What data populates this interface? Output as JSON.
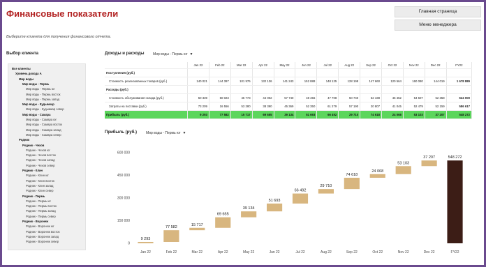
{
  "header": {
    "title": "Финансовые показатели",
    "subtitle": "Выберите клиента для получения финансового отчета.",
    "nav": [
      "Главная страница",
      "Меню менеджера"
    ]
  },
  "client_panel": {
    "label": "Выбор клиента",
    "items": [
      {
        "text": "Все клиенты",
        "level": 0,
        "bold": true
      },
      {
        "text": "Уровень дохода А",
        "level": 1,
        "bold": true
      },
      {
        "text": "Мир воды",
        "level": 2,
        "bold": true
      },
      {
        "text": "Мир воды - Пермь",
        "level": 3,
        "bold": true
      },
      {
        "text": "Мир воды - Пермь юг",
        "level": 4,
        "bold": false
      },
      {
        "text": "Мир воды - Пермь восток",
        "level": 4,
        "bold": false
      },
      {
        "text": "Мир воды - Пермь запад",
        "level": 4,
        "bold": false
      },
      {
        "text": "Мир воды - Кудымкар",
        "level": 3,
        "bold": true
      },
      {
        "text": "Мир воды - Кудымкар север",
        "level": 4,
        "bold": false
      },
      {
        "text": "Мир воды - Самара",
        "level": 3,
        "bold": true
      },
      {
        "text": "Мир воды - Самара юг",
        "level": 4,
        "bold": false
      },
      {
        "text": "Мир воды - Самара восток",
        "level": 4,
        "bold": false
      },
      {
        "text": "Мир воды - Самара запад",
        "level": 4,
        "bold": false
      },
      {
        "text": "Мир воды - Самара север",
        "level": 4,
        "bold": false
      },
      {
        "text": "Родник",
        "level": 2,
        "bold": true
      },
      {
        "text": "Родник - Чехов",
        "level": 3,
        "bold": true
      },
      {
        "text": "Родник - Чехов юг",
        "level": 4,
        "bold": false
      },
      {
        "text": "Родник - Чехов восток",
        "level": 4,
        "bold": false
      },
      {
        "text": "Родник - Чехов запад",
        "level": 4,
        "bold": false
      },
      {
        "text": "Родник - Чехов север",
        "level": 4,
        "bold": false
      },
      {
        "text": "Родник - Клин",
        "level": 3,
        "bold": true
      },
      {
        "text": "Родник - Клин юг",
        "level": 4,
        "bold": false
      },
      {
        "text": "Родник - Клин восток",
        "level": 4,
        "bold": false
      },
      {
        "text": "Родник - Клин запад",
        "level": 4,
        "bold": false
      },
      {
        "text": "Родник - Клин север",
        "level": 4,
        "bold": false
      },
      {
        "text": "Родник - Пермь",
        "level": 3,
        "bold": true
      },
      {
        "text": "Родник - Пермь юг",
        "level": 4,
        "bold": false
      },
      {
        "text": "Родник - Пермь восток",
        "level": 4,
        "bold": false
      },
      {
        "text": "Родник - Пермь запад",
        "level": 4,
        "bold": false
      },
      {
        "text": "Родник - Пермь север",
        "level": 4,
        "bold": false
      },
      {
        "text": "Родник - Воронеж",
        "level": 3,
        "bold": true
      },
      {
        "text": "Родник - Воронеж юг",
        "level": 4,
        "bold": false
      },
      {
        "text": "Родник - Воронеж восток",
        "level": 4,
        "bold": false
      },
      {
        "text": "Родник - Воронеж запад",
        "level": 4,
        "bold": false
      },
      {
        "text": "Родник - Воронеж север",
        "level": 4,
        "bold": false
      }
    ]
  },
  "table_section": {
    "label": "Доходы и расходы",
    "filter": "Мир воды - Пермь юг",
    "columns": [
      "Jan 22",
      "Feb 22",
      "Mar 22",
      "Apr 22",
      "May 22",
      "Jun 22",
      "Jul 22",
      "Aug 22",
      "Sep 22",
      "Oct 22",
      "Nov 22",
      "Dec 22",
      "FY22"
    ],
    "rows": [
      {
        "label": "Поступления (руб.)",
        "kind": "group",
        "values": []
      },
      {
        "label": "Стоимость реализованных товаров (руб.)",
        "kind": "sub",
        "values": [
          "140 021",
          "144 397",
          "101 976",
          "132 136",
          "141 243",
          "152 888",
          "148 125",
          "128 198",
          "147 660",
          "120 564",
          "160 080",
          "144 019",
          "1 678 889"
        ]
      },
      {
        "label": "Расходы (руб.)",
        "kind": "group",
        "values": []
      },
      {
        "label": "Стоимость обслуживания склада (руб.)",
        "kind": "sub",
        "values": [
          "50 339",
          "50 023",
          "45 773",
          "44 002",
          "57 740",
          "48 456",
          "47 708",
          "50 740",
          "52 438",
          "45 452",
          "54 507",
          "52 358",
          "624 000"
        ]
      },
      {
        "label": "Затраты на поставки (руб.)",
        "kind": "sub",
        "values": [
          "73 209",
          "16 556",
          "53 280",
          "38 390",
          "45 369",
          "52 350",
          "61 279",
          "57 190",
          "20 807",
          "41 045",
          "52 479",
          "52 159",
          "586 617"
        ]
      },
      {
        "label": "Прибыль (руб.)",
        "kind": "profit",
        "values": [
          "9 293",
          "77 582",
          "15 717",
          "69 655",
          "39 134",
          "51 693",
          "66 492",
          "29 710",
          "74 618",
          "24 068",
          "53 103",
          "37 207",
          "548 272"
        ]
      }
    ]
  },
  "chart_section": {
    "label": "Прибыль (руб.)",
    "filter": "Мир воды - Пермь юг"
  },
  "chart_data": {
    "type": "waterfall",
    "categories": [
      "Jan 22",
      "Feb 22",
      "Mar 22",
      "Apr 22",
      "May 22",
      "Jun 22",
      "Jul 22",
      "Aug 22",
      "Sep 22",
      "Oct 22",
      "Nov 22",
      "Dec 22",
      "FY22"
    ],
    "values": [
      9293,
      77582,
      15717,
      69655,
      39134,
      51693,
      66492,
      29710,
      74618,
      24068,
      53103,
      37207,
      548272
    ],
    "labels": [
      "9 293",
      "77 582",
      "15 717",
      "69 655",
      "39 134",
      "51 693",
      "66 492",
      "29 710",
      "74 618",
      "24 068",
      "53 103",
      "37 207",
      "548 272"
    ],
    "total_index": 12,
    "yticks": [
      "0",
      "150 000",
      "300 000",
      "450 000",
      "600 000"
    ],
    "ytick_values": [
      0,
      150000,
      300000,
      450000,
      600000
    ],
    "ylim": [
      0,
      600000
    ],
    "grid": false,
    "colors": {
      "step": "#d8b67f",
      "total": "#3c1d16"
    }
  }
}
